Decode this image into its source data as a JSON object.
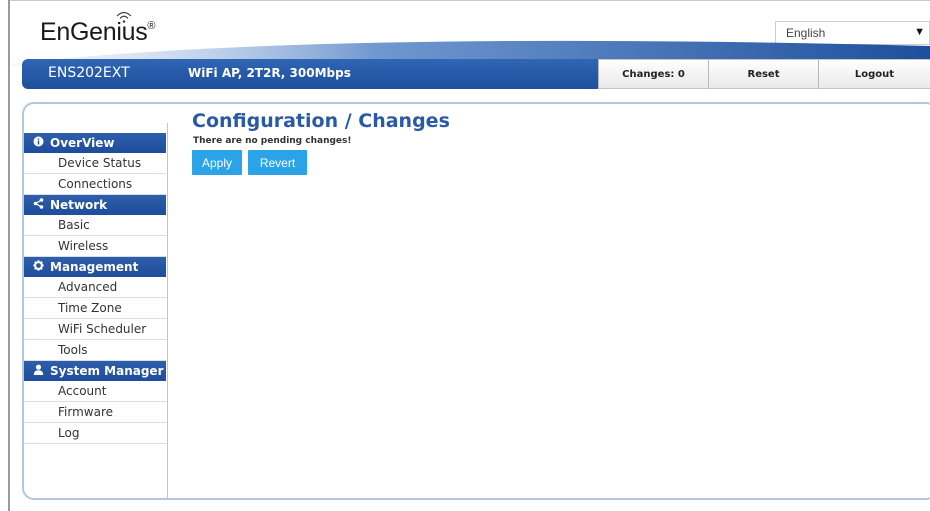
{
  "header": {
    "brand": "EnGenius",
    "brand_mark": "®",
    "language": "English",
    "model": "ENS202EXT",
    "description": "WiFi AP, 2T2R, 300Mbps",
    "changes_label": "Changes: 0",
    "reset_label": "Reset",
    "logout_label": "Logout"
  },
  "sidebar": {
    "sections": [
      {
        "title": "OverView",
        "icon": "info-circle-icon",
        "items": [
          "Device Status",
          "Connections"
        ]
      },
      {
        "title": "Network",
        "icon": "share-icon",
        "items": [
          "Basic",
          "Wireless"
        ]
      },
      {
        "title": "Management",
        "icon": "gear-icon",
        "items": [
          "Advanced",
          "Time Zone",
          "WiFi Scheduler",
          "Tools"
        ]
      },
      {
        "title": "System Manager",
        "icon": "user-icon",
        "items": [
          "Account",
          "Firmware",
          "Log"
        ]
      }
    ]
  },
  "main": {
    "title": "Configuration / Changes",
    "message": "There are no pending changes!",
    "apply_label": "Apply",
    "revert_label": "Revert"
  },
  "colors": {
    "primary_blue": "#2a5aa6",
    "header_bar": "#1d4f9c",
    "button_blue": "#2aa4e6",
    "panel_border": "#b6c6df"
  }
}
